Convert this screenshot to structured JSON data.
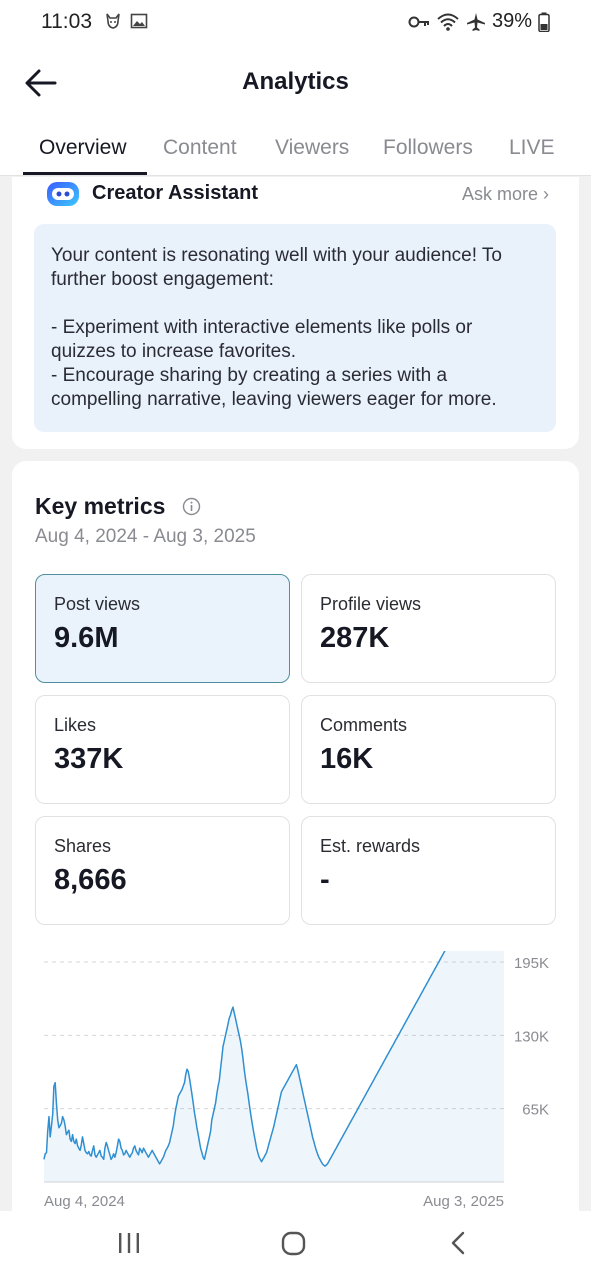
{
  "status": {
    "time": "11:03",
    "battery": "39%"
  },
  "header": {
    "title": "Analytics"
  },
  "tabs": [
    "Overview",
    "Content",
    "Viewers",
    "Followers",
    "LIVE"
  ],
  "assistant": {
    "name": "Creator Assistant",
    "ask_more": "Ask more",
    "message": "Your content is resonating well with your audience! To further boost engagement:\n\n- Experiment with interactive elements like polls or quizzes to increase favorites.\n- Encourage sharing by creating a series with a compelling narrative, leaving viewers eager for more."
  },
  "key_metrics": {
    "title": "Key metrics",
    "date_range": "Aug 4, 2024 - Aug 3, 2025",
    "items": [
      {
        "label": "Post views",
        "value": "9.6M",
        "selected": true
      },
      {
        "label": "Profile views",
        "value": "287K"
      },
      {
        "label": "Likes",
        "value": "337K"
      },
      {
        "label": "Comments",
        "value": "16K"
      },
      {
        "label": "Shares",
        "value": "8,666"
      },
      {
        "label": "Est. rewards",
        "value": "-"
      }
    ]
  },
  "chart_data": {
    "type": "area",
    "series": [
      {
        "color": "#2f8fd1",
        "values": [
          20000,
          25000,
          26000,
          45000,
          58000,
          40000,
          50000,
          60000,
          85000,
          88000,
          70000,
          55000,
          48000,
          50000,
          52000,
          58000,
          55000,
          50000,
          42000,
          44000,
          46000,
          38000,
          36000,
          42000,
          36000,
          34000,
          38000,
          32000,
          30000,
          28000,
          33000,
          40000,
          34000,
          28000,
          26000,
          25000,
          27000,
          24000,
          23000,
          28000,
          32000,
          24000,
          22000,
          24000,
          26000,
          28000,
          23000,
          22000,
          20000,
          30000,
          35000,
          32000,
          28000,
          24000,
          20000,
          22000,
          25000,
          22000,
          26000,
          32000,
          38000,
          36000,
          30000,
          28000,
          24000,
          25000,
          28000,
          26000,
          24000,
          22000,
          24000,
          26000,
          30000,
          32000,
          28000,
          26000,
          24000,
          30000,
          28000,
          26000,
          30000,
          28000,
          26000,
          24000,
          22000,
          24000,
          26000,
          28000,
          26000,
          24000,
          22000,
          20000,
          18000,
          16000,
          18000,
          20000,
          22000,
          25000,
          28000,
          30000,
          32000,
          35000,
          40000,
          45000,
          50000,
          58000,
          65000,
          70000,
          76000,
          78000,
          80000,
          82000,
          85000,
          88000,
          95000,
          100000,
          98000,
          92000,
          85000,
          78000,
          70000,
          62000,
          55000,
          48000,
          42000,
          36000,
          30000,
          26000,
          22000,
          20000,
          25000,
          30000,
          35000,
          40000,
          45000,
          55000,
          60000,
          65000,
          70000,
          78000,
          85000,
          90000,
          100000,
          110000,
          120000,
          125000,
          130000,
          135000,
          140000,
          145000,
          148000,
          152000,
          155000,
          150000,
          145000,
          140000,
          135000,
          130000,
          125000,
          118000,
          110000,
          100000,
          92000,
          85000,
          78000,
          70000,
          62000,
          55000,
          48000,
          42000,
          36000,
          30000,
          26000,
          22000,
          20000,
          18000,
          20000,
          22000,
          24000,
          26000,
          30000,
          34000,
          38000,
          42000,
          46000,
          50000,
          55000,
          60000,
          65000,
          70000,
          75000,
          80000,
          82000,
          84000,
          86000,
          88000,
          90000,
          92000,
          94000,
          96000,
          98000,
          100000,
          102000,
          104000,
          100000,
          95000,
          90000,
          85000,
          80000,
          75000,
          70000,
          65000,
          60000,
          55000,
          50000,
          45000,
          40000,
          36000,
          32000,
          28000,
          25000,
          22000,
          20000,
          18000,
          16000,
          15000,
          14000,
          15000,
          16000,
          18000,
          20000,
          22000,
          24000,
          26000,
          28000,
          30000,
          32000,
          34000,
          36000,
          38000,
          40000,
          42000,
          44000,
          46000,
          48000,
          50000,
          52000,
          54000,
          56000,
          58000,
          60000,
          62000,
          64000,
          66000,
          68000,
          70000,
          72000,
          74000,
          76000,
          78000,
          80000,
          82000,
          84000,
          86000,
          88000,
          90000,
          92000,
          94000,
          96000,
          98000,
          100000,
          102000,
          104000,
          106000,
          108000,
          110000,
          112000,
          114000,
          116000,
          118000,
          120000,
          122000,
          124000,
          126000,
          128000,
          130000,
          132000,
          134000,
          136000,
          138000,
          140000,
          142000,
          144000,
          146000,
          148000,
          150000,
          152000,
          154000,
          156000,
          158000,
          160000,
          162000,
          164000,
          166000,
          168000,
          170000,
          172000,
          174000,
          176000,
          178000,
          180000,
          182000,
          184000,
          186000,
          188000,
          190000,
          192000,
          194000,
          196000,
          198000,
          200000,
          202000,
          204000,
          206000,
          208000,
          210000,
          212000,
          214000,
          216000,
          218000,
          220000,
          222000,
          224000,
          226000,
          228000,
          230000,
          232000,
          234000,
          236000,
          238000,
          240000,
          242000,
          244000,
          246000,
          248000,
          250000,
          252000,
          254000,
          256000,
          258000,
          260000,
          262000,
          264000,
          266000,
          268000,
          270000,
          272000,
          274000,
          276000,
          278000,
          280000,
          282000,
          284000,
          286000,
          288000,
          290000,
          292000,
          294000,
          296000,
          298000,
          300000
        ]
      }
    ],
    "yticks": [
      "195K",
      "130K",
      "65K"
    ],
    "ytick_values": [
      195000,
      130000,
      65000
    ],
    "ylim": [
      0,
      195000
    ],
    "xlabels": [
      "Aug 4, 2024",
      "Aug 3, 2025"
    ]
  }
}
